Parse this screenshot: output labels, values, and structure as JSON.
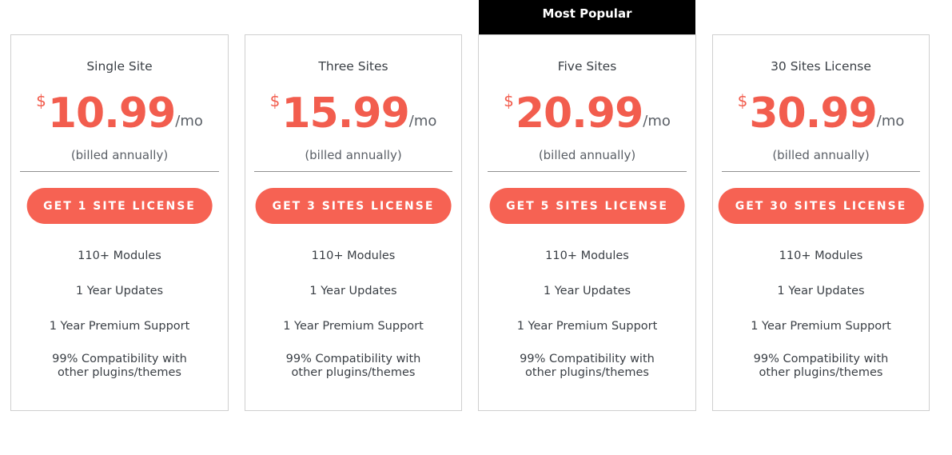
{
  "badge": {
    "label": "Most Popular"
  },
  "colors": {
    "accent": "#f66253",
    "price": "#f25d4e",
    "badge_bg": "#000000",
    "border": "#cfcfcf"
  },
  "plans": [
    {
      "title": "Single Site",
      "currency": "$",
      "amount": "10.99",
      "period": "/mo",
      "billing": "(billed annually)",
      "cta": "GET 1 SITE LICENSE",
      "features": [
        "110+ Modules",
        "1 Year Updates",
        "1 Year Premium Support",
        "99% Compatibility with",
        "other plugins/themes"
      ]
    },
    {
      "title": "Three Sites",
      "currency": "$",
      "amount": "15.99",
      "period": "/mo",
      "billing": "(billed annually)",
      "cta": "GET 3 SITES LICENSE",
      "features": [
        "110+ Modules",
        "1 Year Updates",
        "1 Year Premium Support",
        "99% Compatibility with",
        "other plugins/themes"
      ]
    },
    {
      "title": "Five Sites",
      "currency": "$",
      "amount": "20.99",
      "period": "/mo",
      "billing": "(billed annually)",
      "cta": "GET 5 SITES LICENSE",
      "features": [
        "110+ Modules",
        "1 Year Updates",
        "1 Year Premium Support",
        "99% Compatibility with",
        "other plugins/themes"
      ]
    },
    {
      "title": "30 Sites License",
      "currency": "$",
      "amount": "30.99",
      "period": "/mo",
      "billing": "(billed annually)",
      "cta": "GET 30 SITES LICENSE",
      "features": [
        "110+ Modules",
        "1 Year Updates",
        "1 Year Premium Support",
        "99% Compatibility with",
        "other plugins/themes"
      ]
    }
  ]
}
